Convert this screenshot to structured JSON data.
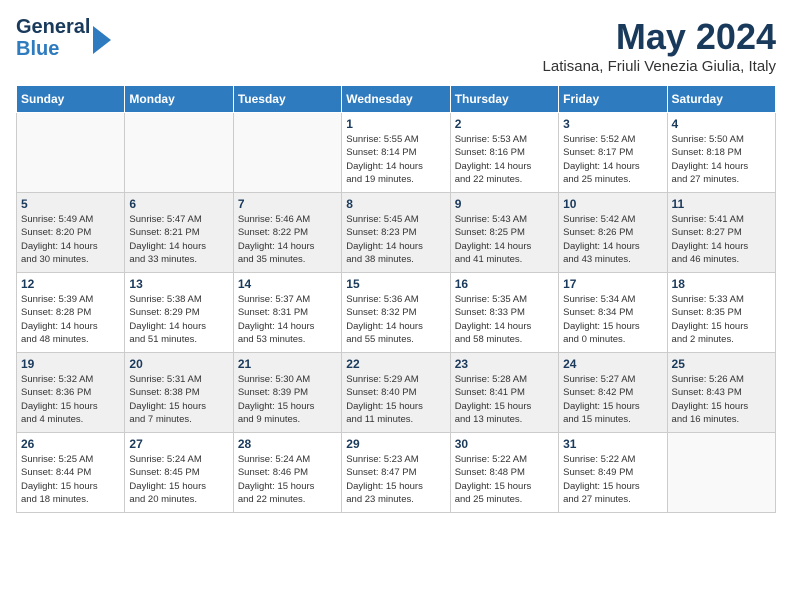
{
  "header": {
    "logo_line1": "General",
    "logo_line2": "Blue",
    "month": "May 2024",
    "location": "Latisana, Friuli Venezia Giulia, Italy"
  },
  "days_of_week": [
    "Sunday",
    "Monday",
    "Tuesday",
    "Wednesday",
    "Thursday",
    "Friday",
    "Saturday"
  ],
  "weeks": [
    [
      {
        "num": "",
        "info": ""
      },
      {
        "num": "",
        "info": ""
      },
      {
        "num": "",
        "info": ""
      },
      {
        "num": "1",
        "info": "Sunrise: 5:55 AM\nSunset: 8:14 PM\nDaylight: 14 hours\nand 19 minutes."
      },
      {
        "num": "2",
        "info": "Sunrise: 5:53 AM\nSunset: 8:16 PM\nDaylight: 14 hours\nand 22 minutes."
      },
      {
        "num": "3",
        "info": "Sunrise: 5:52 AM\nSunset: 8:17 PM\nDaylight: 14 hours\nand 25 minutes."
      },
      {
        "num": "4",
        "info": "Sunrise: 5:50 AM\nSunset: 8:18 PM\nDaylight: 14 hours\nand 27 minutes."
      }
    ],
    [
      {
        "num": "5",
        "info": "Sunrise: 5:49 AM\nSunset: 8:20 PM\nDaylight: 14 hours\nand 30 minutes."
      },
      {
        "num": "6",
        "info": "Sunrise: 5:47 AM\nSunset: 8:21 PM\nDaylight: 14 hours\nand 33 minutes."
      },
      {
        "num": "7",
        "info": "Sunrise: 5:46 AM\nSunset: 8:22 PM\nDaylight: 14 hours\nand 35 minutes."
      },
      {
        "num": "8",
        "info": "Sunrise: 5:45 AM\nSunset: 8:23 PM\nDaylight: 14 hours\nand 38 minutes."
      },
      {
        "num": "9",
        "info": "Sunrise: 5:43 AM\nSunset: 8:25 PM\nDaylight: 14 hours\nand 41 minutes."
      },
      {
        "num": "10",
        "info": "Sunrise: 5:42 AM\nSunset: 8:26 PM\nDaylight: 14 hours\nand 43 minutes."
      },
      {
        "num": "11",
        "info": "Sunrise: 5:41 AM\nSunset: 8:27 PM\nDaylight: 14 hours\nand 46 minutes."
      }
    ],
    [
      {
        "num": "12",
        "info": "Sunrise: 5:39 AM\nSunset: 8:28 PM\nDaylight: 14 hours\nand 48 minutes."
      },
      {
        "num": "13",
        "info": "Sunrise: 5:38 AM\nSunset: 8:29 PM\nDaylight: 14 hours\nand 51 minutes."
      },
      {
        "num": "14",
        "info": "Sunrise: 5:37 AM\nSunset: 8:31 PM\nDaylight: 14 hours\nand 53 minutes."
      },
      {
        "num": "15",
        "info": "Sunrise: 5:36 AM\nSunset: 8:32 PM\nDaylight: 14 hours\nand 55 minutes."
      },
      {
        "num": "16",
        "info": "Sunrise: 5:35 AM\nSunset: 8:33 PM\nDaylight: 14 hours\nand 58 minutes."
      },
      {
        "num": "17",
        "info": "Sunrise: 5:34 AM\nSunset: 8:34 PM\nDaylight: 15 hours\nand 0 minutes."
      },
      {
        "num": "18",
        "info": "Sunrise: 5:33 AM\nSunset: 8:35 PM\nDaylight: 15 hours\nand 2 minutes."
      }
    ],
    [
      {
        "num": "19",
        "info": "Sunrise: 5:32 AM\nSunset: 8:36 PM\nDaylight: 15 hours\nand 4 minutes."
      },
      {
        "num": "20",
        "info": "Sunrise: 5:31 AM\nSunset: 8:38 PM\nDaylight: 15 hours\nand 7 minutes."
      },
      {
        "num": "21",
        "info": "Sunrise: 5:30 AM\nSunset: 8:39 PM\nDaylight: 15 hours\nand 9 minutes."
      },
      {
        "num": "22",
        "info": "Sunrise: 5:29 AM\nSunset: 8:40 PM\nDaylight: 15 hours\nand 11 minutes."
      },
      {
        "num": "23",
        "info": "Sunrise: 5:28 AM\nSunset: 8:41 PM\nDaylight: 15 hours\nand 13 minutes."
      },
      {
        "num": "24",
        "info": "Sunrise: 5:27 AM\nSunset: 8:42 PM\nDaylight: 15 hours\nand 15 minutes."
      },
      {
        "num": "25",
        "info": "Sunrise: 5:26 AM\nSunset: 8:43 PM\nDaylight: 15 hours\nand 16 minutes."
      }
    ],
    [
      {
        "num": "26",
        "info": "Sunrise: 5:25 AM\nSunset: 8:44 PM\nDaylight: 15 hours\nand 18 minutes."
      },
      {
        "num": "27",
        "info": "Sunrise: 5:24 AM\nSunset: 8:45 PM\nDaylight: 15 hours\nand 20 minutes."
      },
      {
        "num": "28",
        "info": "Sunrise: 5:24 AM\nSunset: 8:46 PM\nDaylight: 15 hours\nand 22 minutes."
      },
      {
        "num": "29",
        "info": "Sunrise: 5:23 AM\nSunset: 8:47 PM\nDaylight: 15 hours\nand 23 minutes."
      },
      {
        "num": "30",
        "info": "Sunrise: 5:22 AM\nSunset: 8:48 PM\nDaylight: 15 hours\nand 25 minutes."
      },
      {
        "num": "31",
        "info": "Sunrise: 5:22 AM\nSunset: 8:49 PM\nDaylight: 15 hours\nand 27 minutes."
      },
      {
        "num": "",
        "info": ""
      }
    ]
  ]
}
